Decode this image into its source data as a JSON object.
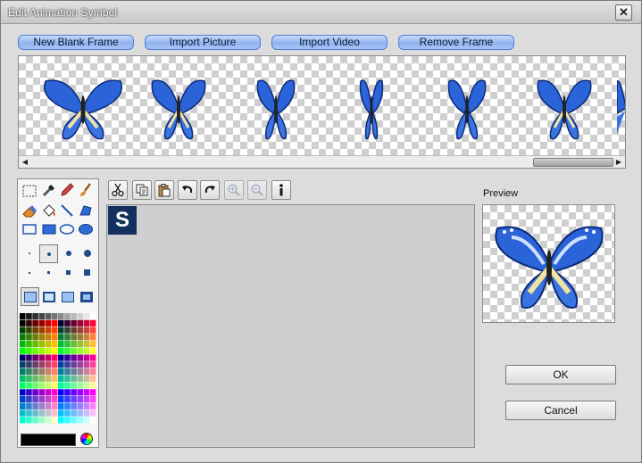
{
  "window": {
    "title": "Edit Animation Symbol",
    "close_glyph": "✕"
  },
  "toolbar": {
    "new_blank_frame": "New Blank Frame",
    "import_picture": "Import Picture",
    "import_video": "Import Video",
    "remove_frame": "Remove Frame"
  },
  "filmstrip": {
    "frame_count_visible": 6,
    "scroll_left_glyph": "◀",
    "scroll_right_glyph": "▶"
  },
  "canvas": {
    "symbol_letter": "S"
  },
  "preview": {
    "label": "Preview"
  },
  "dialog": {
    "ok": "OK",
    "cancel": "Cancel"
  },
  "colors": {
    "accent": "#8fb2ef",
    "butterfly_blue": "#2b63d9",
    "symbol_bg": "#14305e",
    "current_color": "#000000"
  },
  "icons": {
    "tools": [
      "select-rect-icon",
      "eyedropper-icon",
      "pencil-icon",
      "brush-icon",
      "eraser-icon",
      "fill-bucket-icon",
      "line-icon",
      "polygon-icon",
      "rectangle-icon",
      "filled-rectangle-icon",
      "ellipse-icon",
      "filled-ellipse-icon"
    ],
    "edit": [
      "cut-icon",
      "copy-icon",
      "paste-icon",
      "undo-icon",
      "redo-icon",
      "zoom-in-icon",
      "zoom-out-icon",
      "info-icon"
    ]
  }
}
